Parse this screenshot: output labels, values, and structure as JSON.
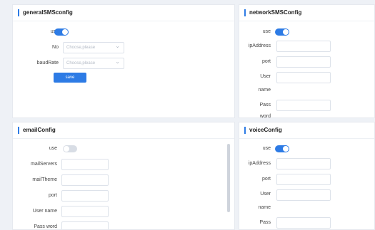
{
  "general": {
    "title": "generalSMSconfig",
    "use_label": "use",
    "no_label": "No",
    "no_placeholder": "Choose,please",
    "baud_label": "baudRate",
    "baud_placeholder": "Choose,please",
    "save_label": "save"
  },
  "network": {
    "title": "networkSMSConfig",
    "use_label": "use",
    "ip_label": "ipAddress",
    "port_label": "port",
    "user_label_1": "User",
    "user_label_2": "name",
    "pass_label_1": "Pass",
    "pass_label_2": "word"
  },
  "email": {
    "title": "emailConfig",
    "use_label": "use",
    "servers_label": "mailServers",
    "theme_label": "mailTheme",
    "port_label": "port",
    "user_label": "User name",
    "pass_label": "Pass word"
  },
  "voice": {
    "title": "voiceConfig",
    "use_label": "use",
    "ip_label": "ipAddress",
    "port_label": "port",
    "user_label_1": "User",
    "user_label_2": "name",
    "pass_label": "Pass"
  },
  "colors": {
    "accent": "#2d7be5"
  }
}
